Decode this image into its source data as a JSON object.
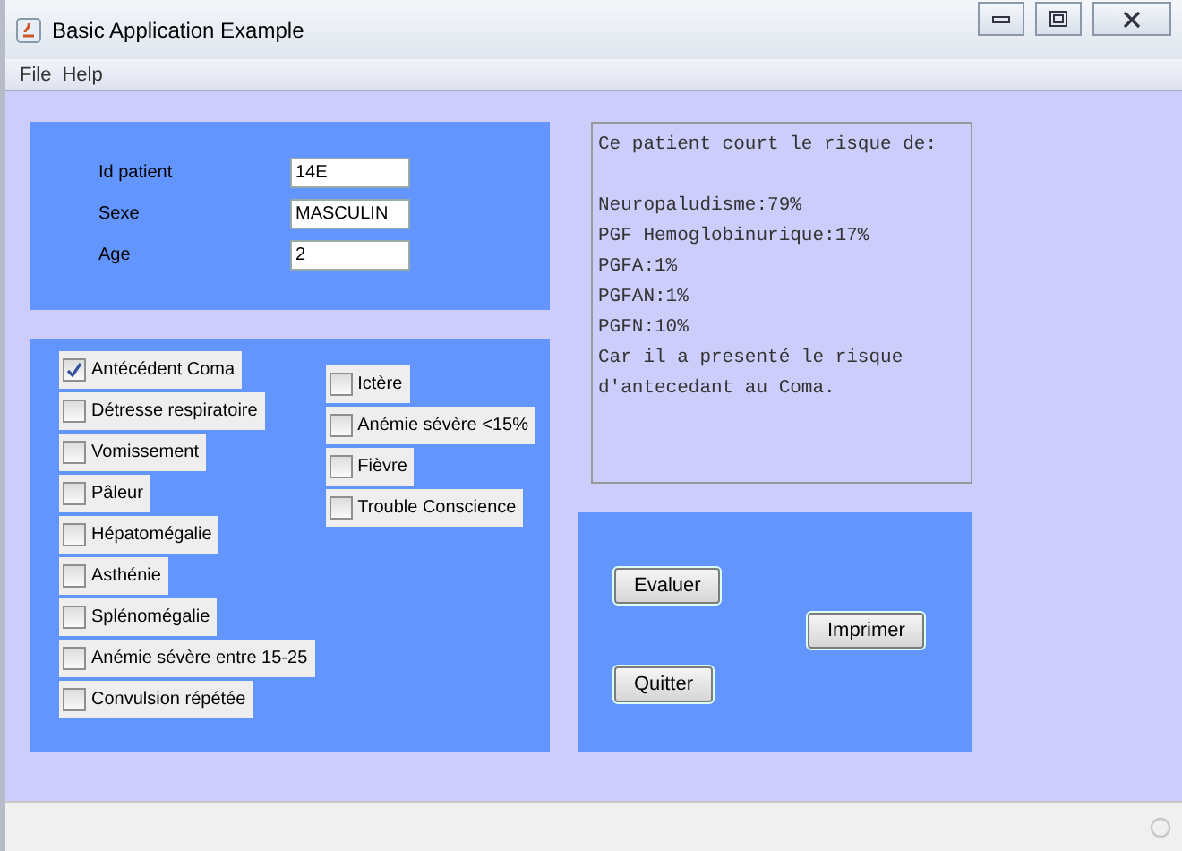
{
  "window": {
    "title": "Basic Application Example"
  },
  "menu": [
    "File",
    "Help"
  ],
  "patient_fields": [
    {
      "label": "Id patient",
      "value": "14E"
    },
    {
      "label": "Sexe",
      "value": "MASCULIN"
    },
    {
      "label": "Age",
      "value": "2"
    }
  ],
  "symptoms": {
    "column_1": [
      {
        "label": "Antécédent Coma",
        "checked": true
      },
      {
        "label": "Détresse respiratoire",
        "checked": false
      },
      {
        "label": "Vomissement",
        "checked": false
      },
      {
        "label": "Pâleur",
        "checked": false
      },
      {
        "label": "Hépatomégalie",
        "checked": false
      },
      {
        "label": "Asthénie",
        "checked": false
      },
      {
        "label": "Splénomégalie",
        "checked": false
      },
      {
        "label": "Anémie sévère entre 15-25",
        "checked": false
      },
      {
        "label": "Convulsion répétée",
        "checked": false
      }
    ],
    "column_2": [
      {
        "label": "Ictère",
        "checked": false
      },
      {
        "label": "Anémie sévère <15%",
        "checked": false
      },
      {
        "label": "Fièvre",
        "checked": false
      },
      {
        "label": "Trouble Conscience",
        "checked": false
      }
    ]
  },
  "result": {
    "heading": "Ce patient court le risque de:",
    "lines": [
      "Neuropaludisme:79%",
      "PGF Hemoglobinurique:17%",
      "PGFA:1%",
      "PGFAN:1%",
      "PGFN:10%",
      "Car il a presenté le risque",
      "d'antecedant au Coma."
    ]
  },
  "buttons": {
    "evaluate": "Evaluer",
    "quit": "Quitter",
    "print": "Imprimer"
  }
}
